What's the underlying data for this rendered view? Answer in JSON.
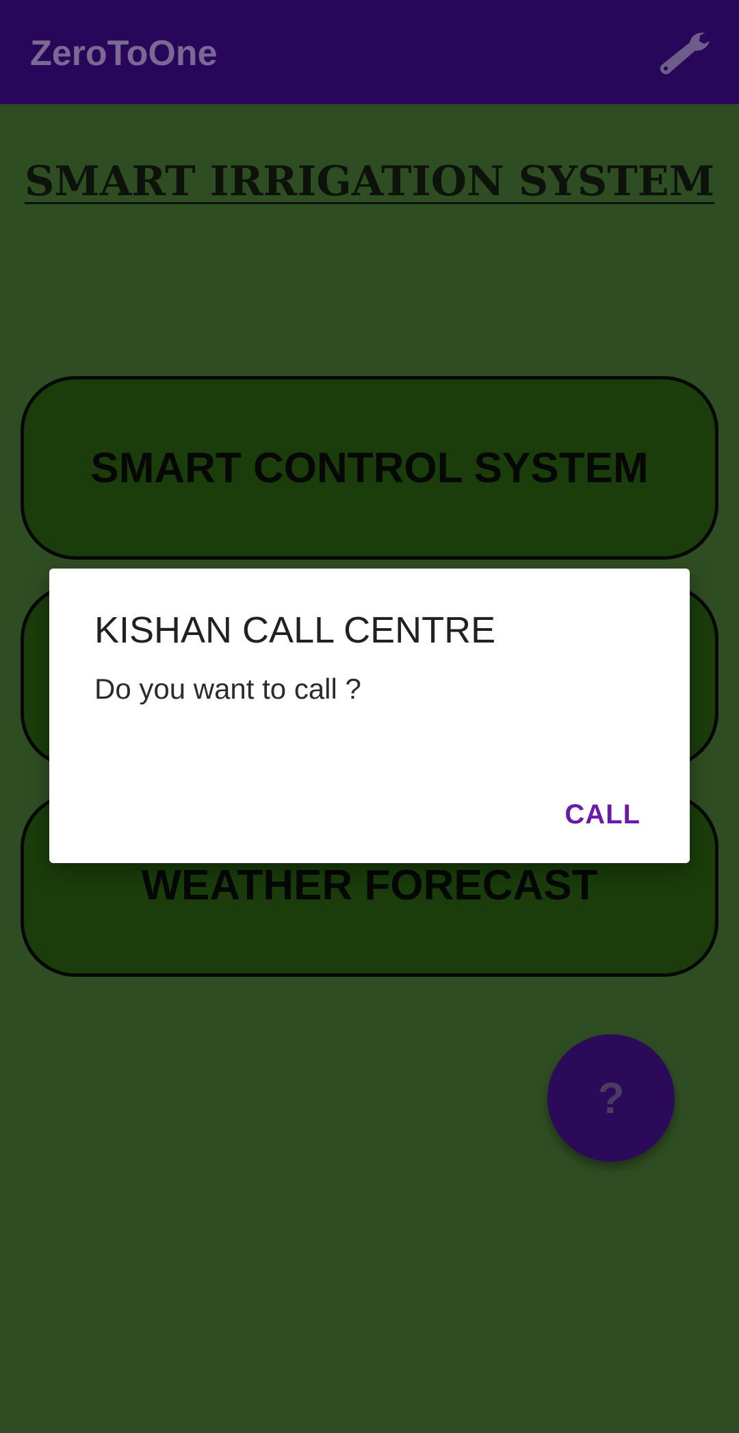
{
  "app_bar": {
    "title": "ZeroToOne",
    "settings_icon": "wrench-icon"
  },
  "main": {
    "title": "SMART IRRIGATION SYSTEM",
    "buttons": [
      {
        "label": "SMART CONTROL SYSTEM"
      },
      {
        "label": ""
      },
      {
        "label": "WEATHER FORECAST"
      }
    ],
    "help_fab": {
      "label": "?"
    }
  },
  "dialog": {
    "title": "KISHAN CALL CENTRE",
    "message": "Do you want to call ?",
    "positive_button": "CALL"
  },
  "colors": {
    "app_bar": "#28075a",
    "background": "#2f4d22",
    "button_fill": "#1a3d0b",
    "accent": "#6a1aa8"
  }
}
